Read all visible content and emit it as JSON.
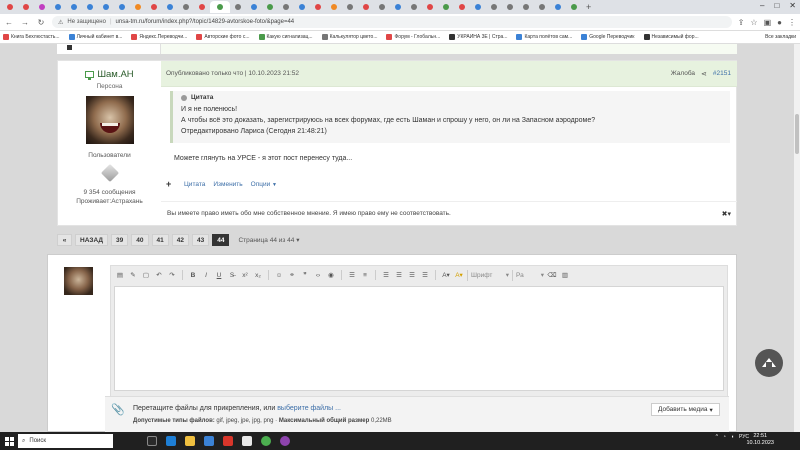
{
  "browser": {
    "not_secure": "Не защищено",
    "url": "unsa-tm.ru/forum/index.php?/topic/14829-avtorskoe-foto/&page=44",
    "bookmarks": [
      "Книга Бехлюстасть...",
      "Личный кабинет в...",
      "Яндекс.Переводчи...",
      "Авторские фото с...",
      "Какую сигнализац...",
      "Калькулятор цвето...",
      "Форум - Глобальн...",
      "УКРАИНА 3E | Стра...",
      "Карта полётов сам...",
      "Google Переводчик",
      "Независимый фор..."
    ],
    "bookmarks_right": "Все закладки"
  },
  "post": {
    "author": "Шам.АН",
    "author_title": "Персона",
    "group": "Пользователи",
    "message_count": "9 354 сообщения",
    "location": "Проживает:Астрахань",
    "published": "Опубликовано только что | 10.10.2023 21:52",
    "report": "Жалоба",
    "number": "#2151",
    "quote": {
      "label": "Цитата",
      "line1": "И я не поленюсь!",
      "line2": "А чтобы всё это доказать, зарегистрируюсь на всех форумах, где есть Шаман и спрошу у него, он ли на Запасном аэродроме?",
      "line3": "Отредактировано Лариса (Сегодня 21:48:21)"
    },
    "body": "Можете глянуть на УРСЕ - я этот пост перенесу туда...",
    "actions": {
      "quote": "Цитата",
      "edit": "Изменить",
      "options": "Опции"
    },
    "signature": "Вы имеете право иметь обо мне собственное мнение. Я имею право ему не соответствовать."
  },
  "pagination": {
    "back": "НАЗАД",
    "pages": [
      "39",
      "40",
      "41",
      "42",
      "43",
      "44"
    ],
    "current": "44",
    "info": "Страница 44 из 44"
  },
  "editor": {
    "font_placeholder": "Шрифт",
    "size_placeholder": "Ра",
    "drop_text": "Перетащите файлы для прикрепления, или ",
    "choose_files": "выберите файлы ...",
    "allowed_label": "Допустимые типы файлов:",
    "allowed_types": " gif, jpeg, jpe, jpg, png",
    "max_label": "Максимальный общий размер",
    "max_value": " 0,22MB",
    "add_media": "Добавить медиа"
  },
  "taskbar": {
    "search": "Поиск",
    "lang": "РУС",
    "time": "22:51",
    "date": "10.10.2023"
  }
}
